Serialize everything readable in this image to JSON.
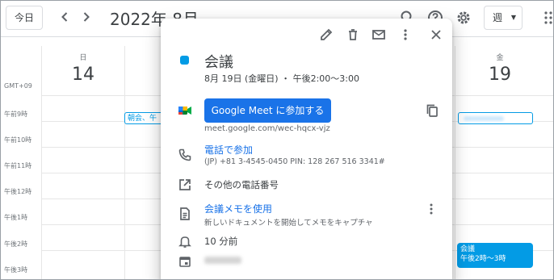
{
  "toolbar": {
    "today_label": "今日",
    "month_title": "2022年 8月",
    "view_label": "週",
    "icons": [
      "search-icon",
      "help-icon",
      "settings-icon",
      "apps-grid-icon"
    ]
  },
  "grid": {
    "timezone": "GMT+09",
    "times": [
      "午前9時",
      "午前10時",
      "午前11時",
      "午後12時",
      "午後1時",
      "午後2時",
      "午後3時"
    ],
    "days": [
      {
        "abbr": "日",
        "num": "14"
      },
      {
        "abbr": "金",
        "num": "19"
      }
    ],
    "event_chip": "朝会、午",
    "event_block": {
      "title": "会議",
      "time": "午後2時～3時"
    },
    "accent_color": "#039be5"
  },
  "popup": {
    "title": "会議",
    "when": "8月 19日 (金曜日) ・ 午後2:00～3:00",
    "color": "#039be5",
    "meet_button": "Google Meet に参加する",
    "meet_url": "meet.google.com/wec-hqcx-vjz",
    "phone_link": "電話で参加",
    "phone_detail": "(JP) +81 3-4545-0450 PIN: 128 267 516 3341#",
    "more_numbers": "その他の電話番号",
    "notes_link": "会議メモを使用",
    "notes_detail": "新しいドキュメントを開始してメモをキャプチャ",
    "reminder": "10 分前",
    "header_icons": [
      "edit-icon",
      "delete-icon",
      "email-icon",
      "more-options-icon",
      "close-icon"
    ]
  }
}
